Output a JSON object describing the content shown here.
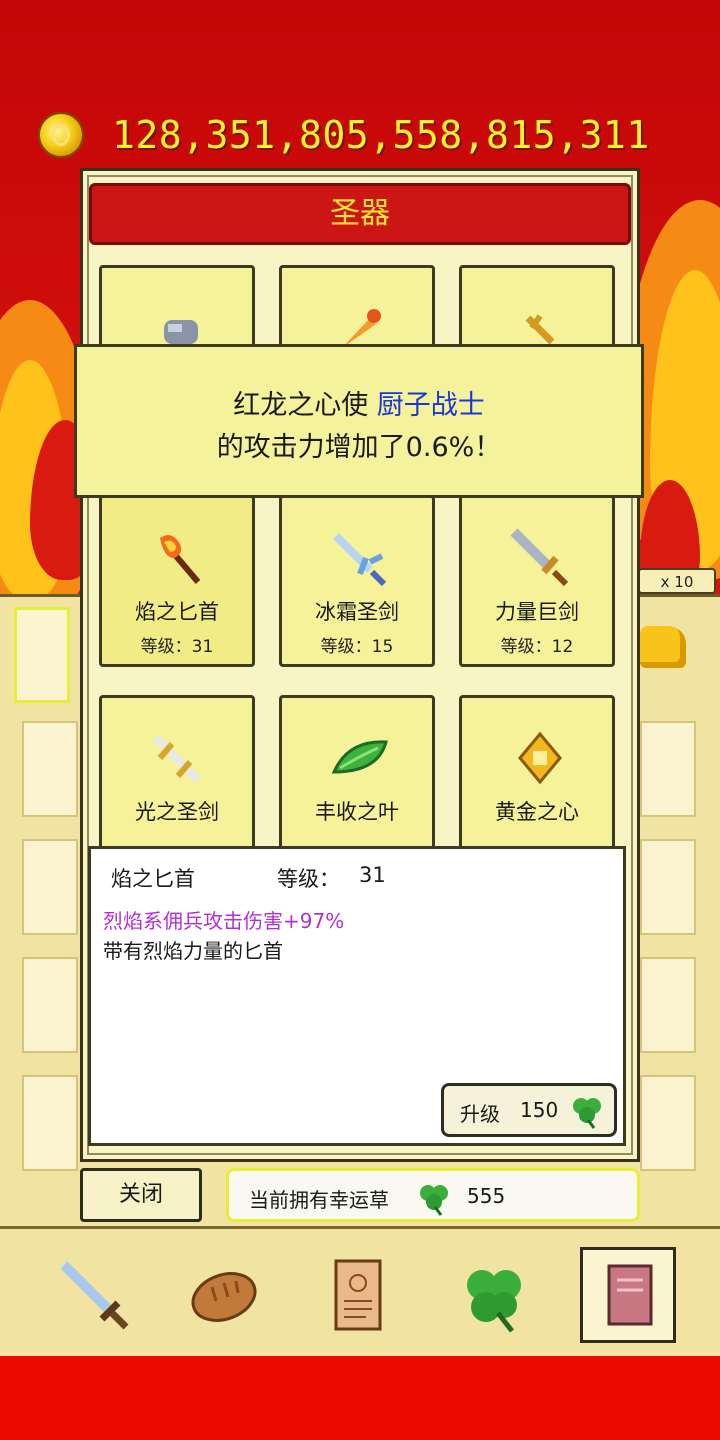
{
  "header": {
    "coins": "128,351,805,558,815,311"
  },
  "inventory": {
    "multiplier": "x 10"
  },
  "modal": {
    "title": "圣器",
    "cards": [
      {
        "name": "",
        "level_label": "",
        "level": "",
        "icon": "hammer-icon"
      },
      {
        "name": "",
        "level_label": "",
        "level": "",
        "icon": "flame-sword-icon"
      },
      {
        "name": "",
        "level_label": "",
        "level": "",
        "icon": "golden-cross-icon"
      },
      {
        "name": "焰之匕首",
        "level_label": "等级：",
        "level": "31",
        "icon": "flame-dagger-icon"
      },
      {
        "name": "冰霜圣剑",
        "level_label": "等级：",
        "level": "15",
        "icon": "frost-sword-icon"
      },
      {
        "name": "力量巨剑",
        "level_label": "等级：",
        "level": "12",
        "icon": "great-sword-icon"
      },
      {
        "name": "光之圣剑",
        "level_label": "",
        "level": "",
        "icon": "light-sword-icon"
      },
      {
        "name": "丰收之叶",
        "level_label": "",
        "level": "",
        "icon": "leaf-icon"
      },
      {
        "name": "黄金之心",
        "level_label": "",
        "level": "",
        "icon": "golden-heart-icon"
      }
    ],
    "toast": {
      "line1_prefix": "红龙之心使 ",
      "line1_highlight": "厨子战士",
      "line2": "的攻击力增加了0.6%！"
    },
    "detail": {
      "name": "焰之匕首",
      "level_label": "等级：",
      "level": "31",
      "effect": "烈焰系佣兵攻击伤害+97%",
      "description": "带有烈焰力量的匕首",
      "upgrade_label": "升级",
      "upgrade_cost": "150"
    },
    "close_label": "关闭",
    "luck": {
      "label": "当前拥有幸运草",
      "value": "555"
    }
  },
  "nav": [
    {
      "icon": "sword-icon",
      "active": false
    },
    {
      "icon": "bread-icon",
      "active": false
    },
    {
      "icon": "scroll-icon",
      "active": false
    },
    {
      "icon": "clover-icon",
      "active": false
    },
    {
      "icon": "book-icon",
      "active": true
    }
  ],
  "colors": {
    "accent_red": "#cc1616",
    "title_text": "#ffe433",
    "highlight_blue": "#1a36d6",
    "effect_purple": "#b030d8",
    "coin_text": "#fff52a"
  }
}
